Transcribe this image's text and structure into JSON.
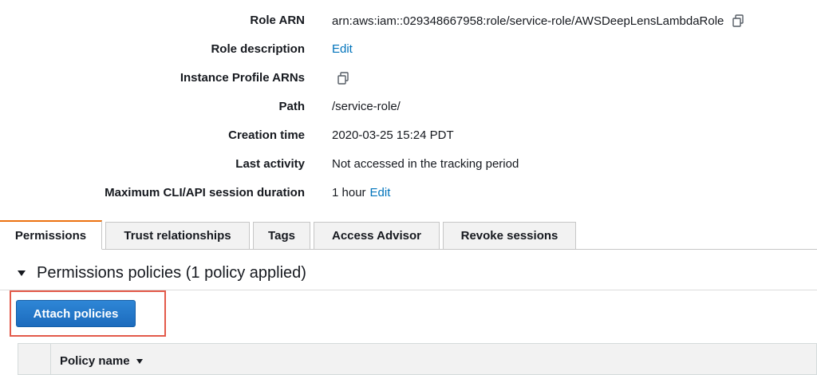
{
  "summary": {
    "rows": [
      {
        "label": "Role ARN",
        "value": "arn:aws:iam::029348667958:role/service-role/AWSDeepLensLambdaRole"
      },
      {
        "label": "Role description",
        "link": "Edit"
      },
      {
        "label": "Instance Profile ARNs"
      },
      {
        "label": "Path",
        "value": "/service-role/"
      },
      {
        "label": "Creation time",
        "value": "2020-03-25 15:24 PDT"
      },
      {
        "label": "Last activity",
        "value": "Not accessed in the tracking period"
      },
      {
        "label": "Maximum CLI/API session duration",
        "value": "1 hour",
        "link": "Edit"
      }
    ]
  },
  "tabs": [
    {
      "label": "Permissions",
      "active": true
    },
    {
      "label": "Trust relationships"
    },
    {
      "label": "Tags"
    },
    {
      "label": "Access Advisor"
    },
    {
      "label": "Revoke sessions"
    }
  ],
  "permissions": {
    "section_title": "Permissions policies (1 policy applied)",
    "attach_button": "Attach policies",
    "table": {
      "columns": [
        "Policy name"
      ]
    }
  },
  "icons": {
    "copy": "copy-icon",
    "collapse": "caret-down-icon",
    "sort": "sort-down-icon"
  },
  "colors": {
    "link": "#0073bb",
    "primary": "#1c6bbd",
    "active_tab_accent": "#ec7211",
    "highlight": "#e35a4a"
  }
}
